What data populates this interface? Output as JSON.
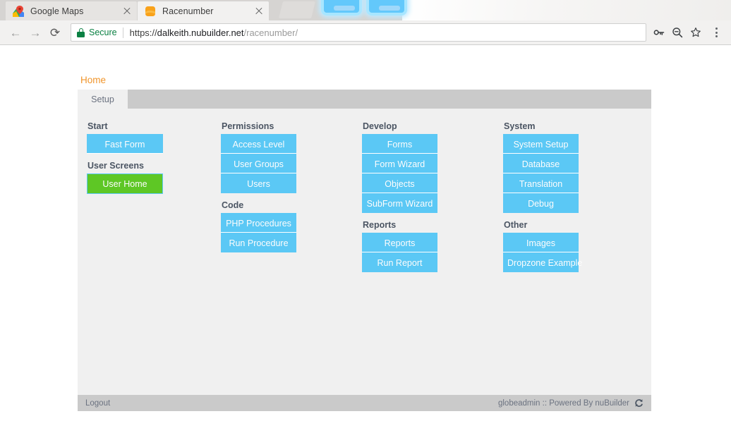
{
  "browser": {
    "tabs": [
      {
        "title": "Google Maps",
        "favicon": "google-maps-favicon",
        "active": false
      },
      {
        "title": "Racenumber",
        "favicon": "racenumber-favicon",
        "active": true
      }
    ],
    "nav": {
      "back_label": "←",
      "forward_label": "→",
      "reload_label": "⟳"
    },
    "omnibox": {
      "security_label": "Secure",
      "security_icon": "lock-icon",
      "url_scheme": "https://",
      "url_host": "dalkeith.nubuilder.net",
      "url_path": "/racenumber/",
      "url_full": "https://dalkeith.nubuilder.net/racenumber/",
      "actions": [
        {
          "name": "password-key-icon",
          "glyph": "⚷"
        },
        {
          "name": "zoom-out-icon",
          "glyph": "⊖"
        },
        {
          "name": "bookmark-star-icon",
          "glyph": "☆"
        }
      ]
    },
    "menu_icon": "three-dot-menu-icon"
  },
  "page": {
    "breadcrumb": "Home",
    "form_tabs": [
      {
        "label": "Setup",
        "active": true
      }
    ],
    "columns": [
      {
        "name": "column-start",
        "groups": [
          {
            "title": "Start",
            "buttons": [
              {
                "label": "Fast Form",
                "style": "blue"
              }
            ]
          },
          {
            "title": "User Screens",
            "buttons": [
              {
                "label": "User Home",
                "style": "green"
              }
            ]
          }
        ]
      },
      {
        "name": "column-permissions",
        "groups": [
          {
            "title": "Permissions",
            "buttons": [
              {
                "label": "Access Level",
                "style": "blue"
              },
              {
                "label": "User Groups",
                "style": "blue"
              },
              {
                "label": "Users",
                "style": "blue"
              }
            ]
          },
          {
            "title": "Code",
            "buttons": [
              {
                "label": "PHP Procedures",
                "style": "blue"
              },
              {
                "label": "Run Procedure",
                "style": "blue"
              }
            ]
          }
        ]
      },
      {
        "name": "column-develop",
        "groups": [
          {
            "title": "Develop",
            "buttons": [
              {
                "label": "Forms",
                "style": "blue"
              },
              {
                "label": "Form Wizard",
                "style": "blue"
              },
              {
                "label": "Objects",
                "style": "blue"
              },
              {
                "label": "SubForm Wizard",
                "style": "blue"
              }
            ]
          },
          {
            "title": "Reports",
            "buttons": [
              {
                "label": "Reports",
                "style": "blue"
              },
              {
                "label": "Run Report",
                "style": "blue"
              }
            ]
          }
        ]
      },
      {
        "name": "column-system",
        "groups": [
          {
            "title": "System",
            "buttons": [
              {
                "label": "System Setup",
                "style": "blue"
              },
              {
                "label": "Database",
                "style": "blue"
              },
              {
                "label": "Translation",
                "style": "blue"
              },
              {
                "label": "Debug",
                "style": "blue"
              }
            ]
          },
          {
            "title": "Other",
            "buttons": [
              {
                "label": "Images",
                "style": "blue"
              },
              {
                "label": "Dropzone Example",
                "style": "blue"
              }
            ]
          }
        ]
      }
    ],
    "statusbar": {
      "logout_label": "Logout",
      "credit": "globeadmin :: Powered By nuBuilder",
      "refresh_icon": "refresh-icon"
    }
  },
  "colors": {
    "accent_blue": "#5bc8f5",
    "accent_green": "#5ec725",
    "breadcrumb_orange": "#f0952b",
    "secure_green": "#0b8043",
    "panel_bg": "#f0f0f0",
    "tabbar_gray": "#cacaca"
  }
}
